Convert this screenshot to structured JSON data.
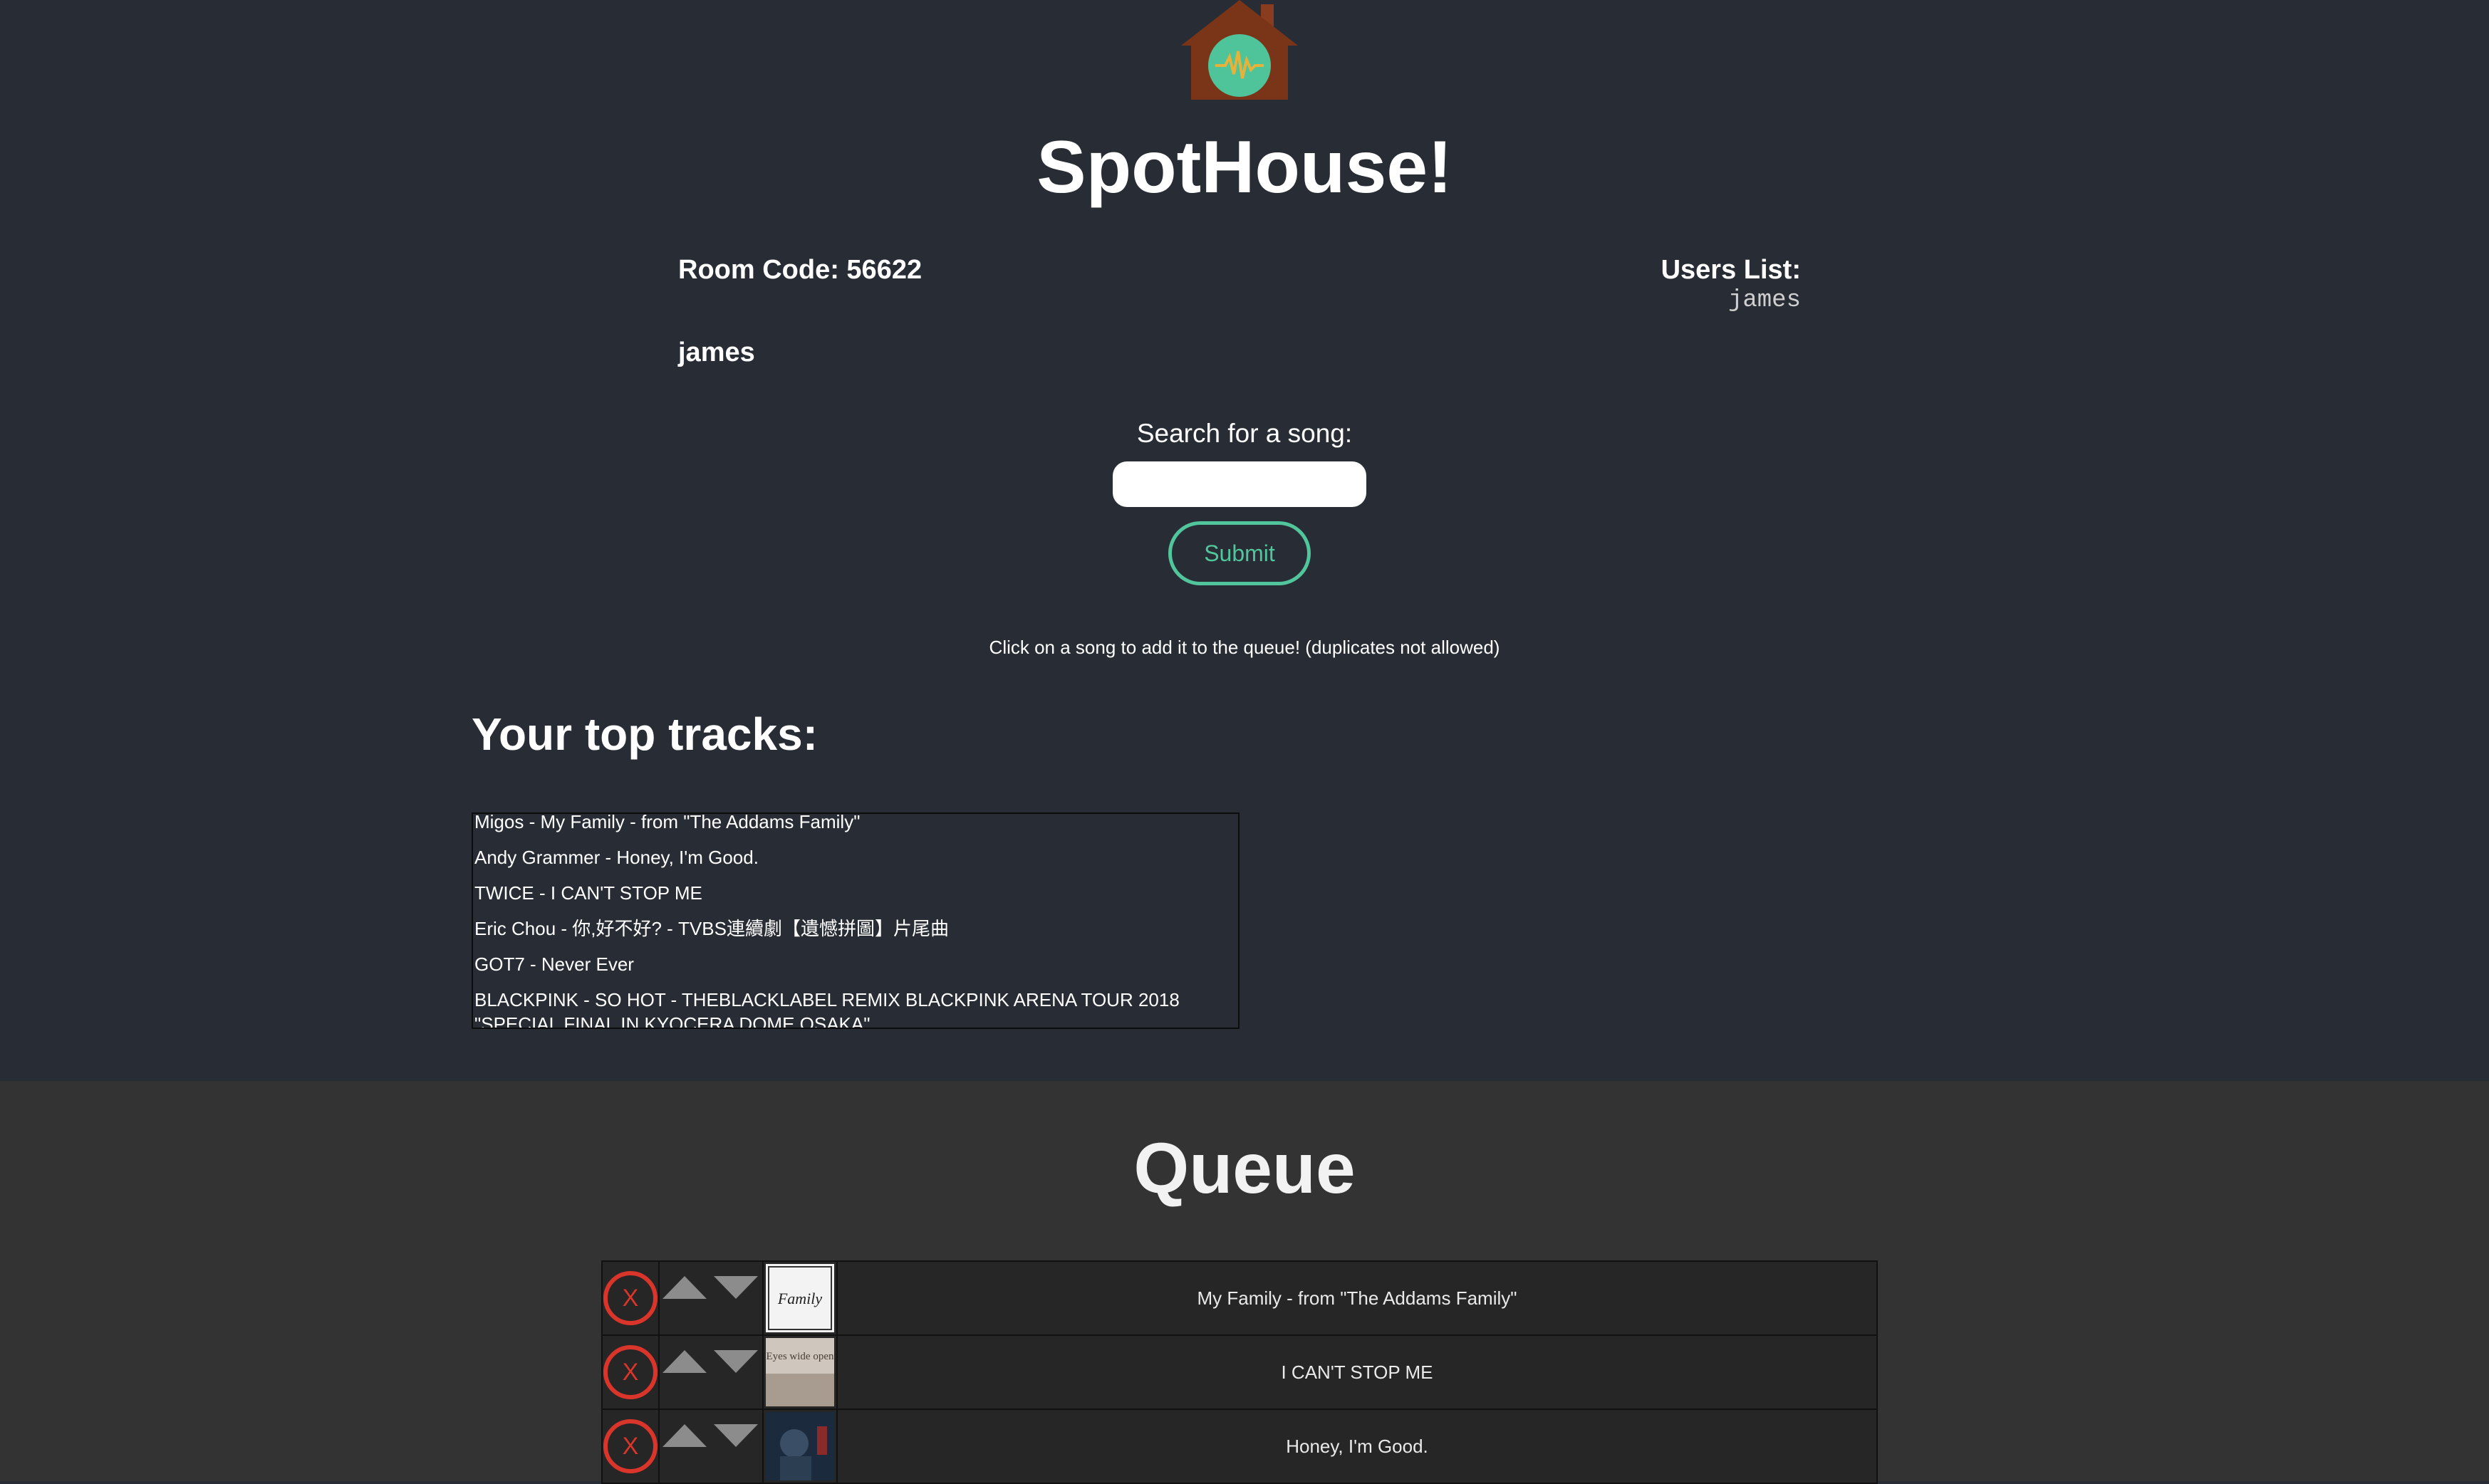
{
  "app": {
    "title": "SpotHouse!"
  },
  "room": {
    "code_label": "Room Code: 56622",
    "username": "james"
  },
  "users": {
    "title": "Users List:",
    "items": [
      "james"
    ]
  },
  "search": {
    "label": "Search for a song:",
    "value": "",
    "placeholder": "",
    "submit_label": "Submit"
  },
  "hint": "Click on a song to add it to the queue! (duplicates not allowed)",
  "top_tracks": {
    "title": "Your top tracks:",
    "items": [
      "Migos - My Family - from \"The Addams Family\"",
      "Andy Grammer - Honey, I'm Good.",
      "TWICE - I CAN'T STOP ME",
      "Eric Chou - 你,好不好? - TVBS連續劇【遺憾拼圖】片尾曲",
      "GOT7 - Never Ever",
      "BLACKPINK - SO HOT - THEBLACKLABEL REMIX BLACKPINK ARENA TOUR 2018 \"SPECIAL FINAL IN KYOCERA DOME OSAKA\""
    ]
  },
  "queue": {
    "title": "Queue",
    "remove_label": "X",
    "items": [
      {
        "name": "My Family - from \"The Addams Family\"",
        "art_text": "Family"
      },
      {
        "name": "I CAN'T STOP ME",
        "art_text": "Eyes wide open"
      },
      {
        "name": "Honey, I'm Good.",
        "art_text": ""
      }
    ]
  },
  "colors": {
    "background_top": "#282c34",
    "background_bottom": "#333333",
    "accent": "#51c59b",
    "remove": "#d9352a"
  }
}
